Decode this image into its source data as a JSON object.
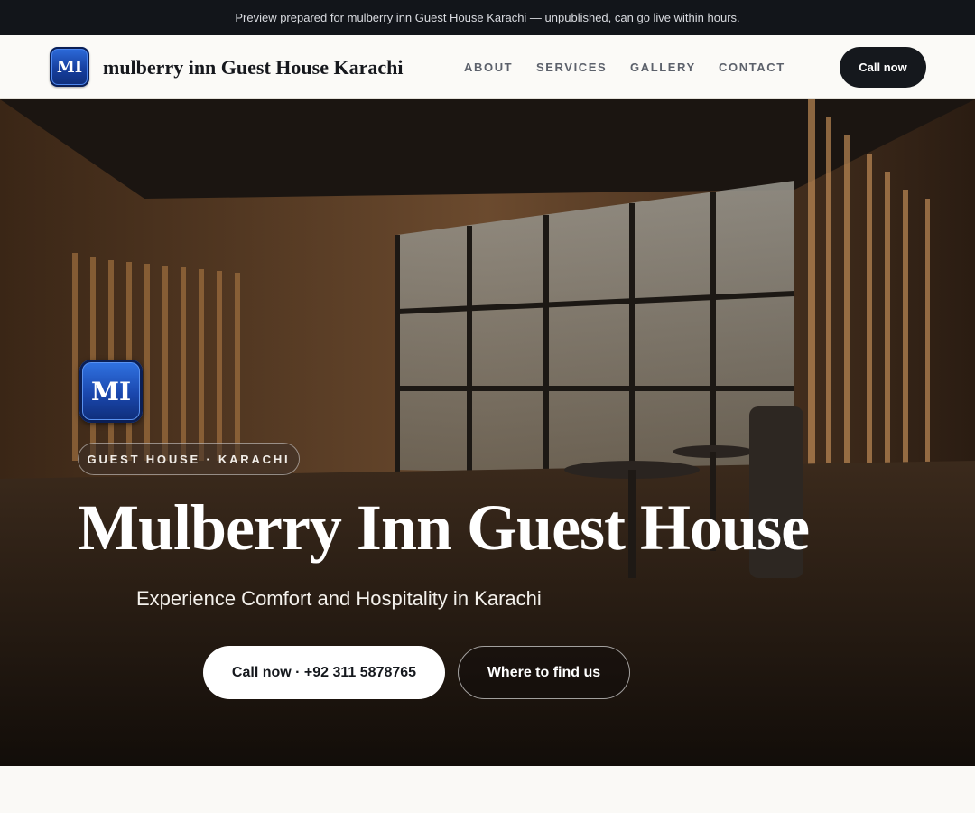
{
  "banner": {
    "text": "Preview prepared for mulberry inn Guest House Karachi — unpublished, can go live within hours."
  },
  "header": {
    "logo_text": "MI",
    "brand": "mulberry inn Guest House Karachi",
    "nav": [
      {
        "label": "ABOUT"
      },
      {
        "label": "SERVICES"
      },
      {
        "label": "GALLERY"
      },
      {
        "label": "CONTACT"
      }
    ],
    "cta_label": "Call now"
  },
  "hero": {
    "logo_text": "MI",
    "eyebrow": "GUEST HOUSE · KARACHI",
    "title": "Mulberry Inn Guest House",
    "subtitle": "Experience Comfort and Hospitality in Karachi",
    "primary_button": "Call now · +92 311 5878765",
    "secondary_button": "Where to find us",
    "background_image": "dim-lit-lobby-with-glass-doors-and-wooden-slats"
  },
  "colors": {
    "banner_bg": "#12151a",
    "header_bg": "#fbfaf7",
    "dark_button": "#15181d",
    "logo_blue": "#1a47ad",
    "page_bg": "#faf9f6"
  }
}
